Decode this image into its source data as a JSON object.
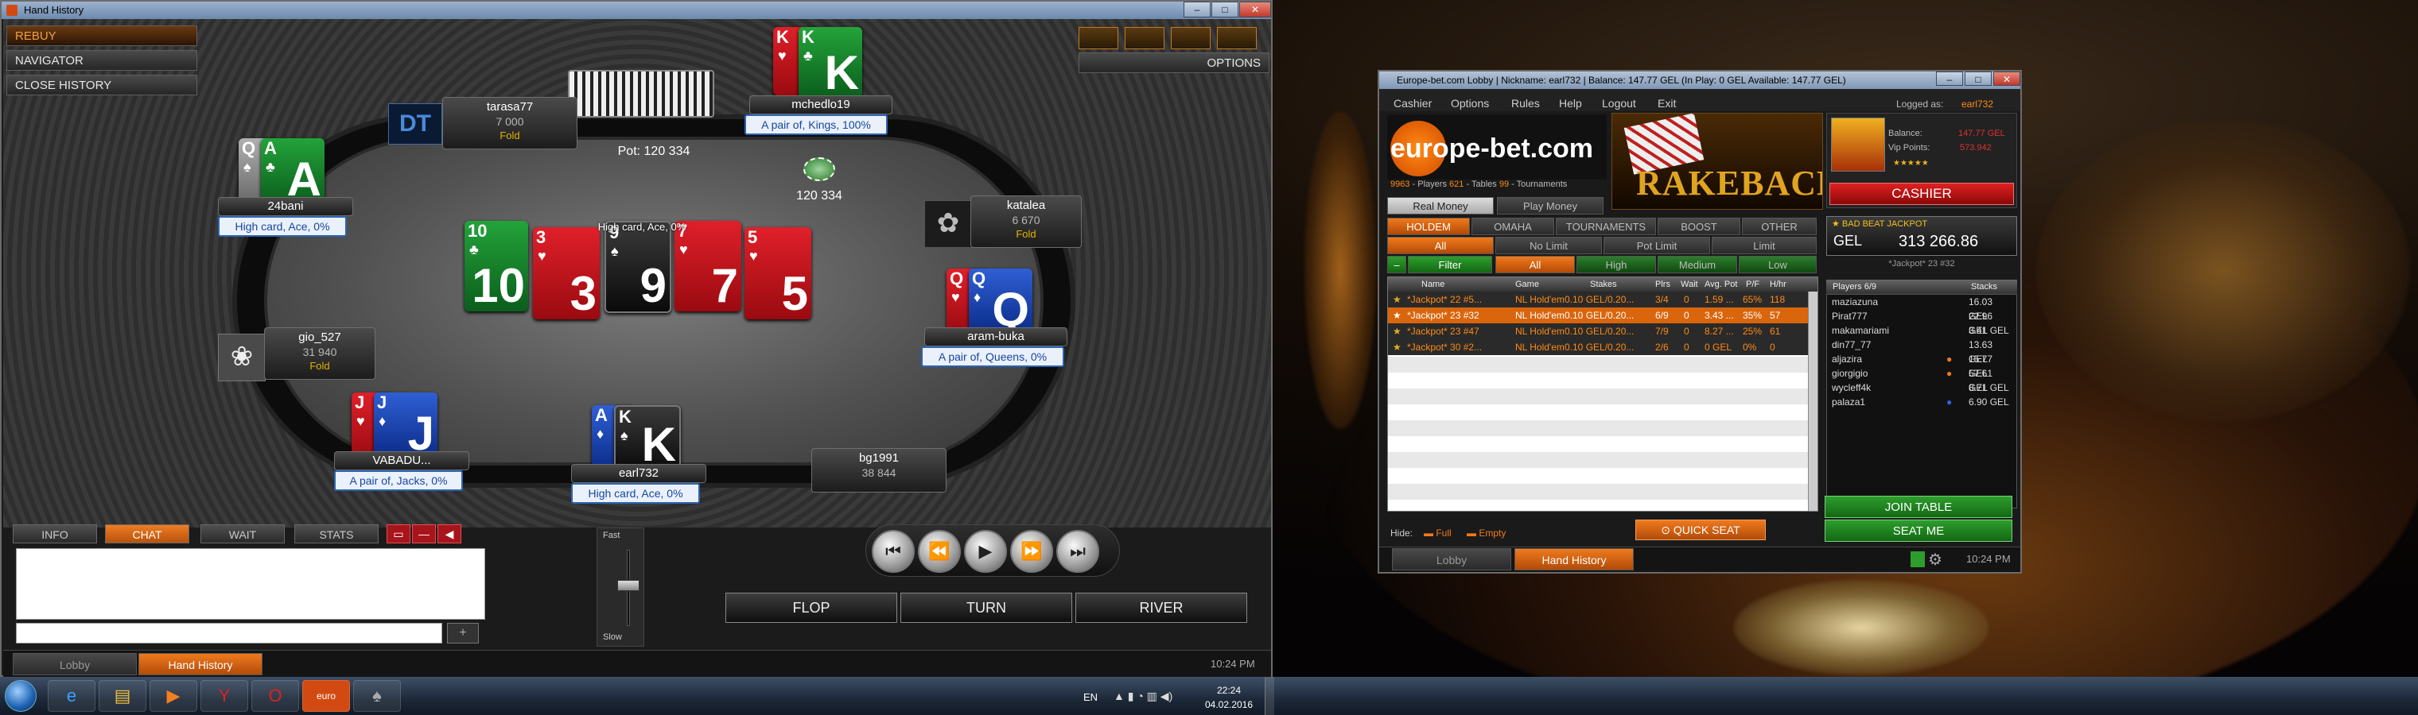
{
  "hand_history": {
    "title": "Hand History",
    "rebuy": "REBUY",
    "navigator": "NAVIGATOR",
    "close_history": "CLOSE HISTORY",
    "options": "OPTIONS",
    "pot": "Pot: 120 334",
    "pot_chips": "120 334",
    "board_caption": "High card, Ace, 0%",
    "board": [
      {
        "rank": "10",
        "suit": "♣",
        "color": "green"
      },
      {
        "rank": "3",
        "suit": "♥",
        "color": "red"
      },
      {
        "rank": "9",
        "suit": "♠",
        "color": "black"
      },
      {
        "rank": "7",
        "suit": "♥",
        "color": "red"
      },
      {
        "rank": "5",
        "suit": "♥",
        "color": "red"
      }
    ],
    "seats": {
      "tarasa77": {
        "name": "tarasa77",
        "chips": "7 000",
        "action": "Fold"
      },
      "mchedlo19": {
        "name": "mchedlo19",
        "hand": "A pair of, Kings, 100%",
        "cards": [
          {
            "rank": "K",
            "suit": "♥",
            "color": "red"
          },
          {
            "rank": "K",
            "suit": "♣",
            "color": "green"
          }
        ]
      },
      "b24bani": {
        "name": "24bani",
        "hand": "High card, Ace, 0%",
        "cards": [
          {
            "rank": "Q",
            "suit": "♠",
            "color": "grey"
          },
          {
            "rank": "A",
            "suit": "♣",
            "color": "green"
          }
        ]
      },
      "katalea": {
        "name": "katalea",
        "chips": "6 670",
        "action": "Fold"
      },
      "gio_527": {
        "name": "gio_527",
        "chips": "31 940",
        "action": "Fold"
      },
      "aram_buka": {
        "name": "aram-buka",
        "hand": "A pair of, Queens, 0%",
        "cards": [
          {
            "rank": "Q",
            "suit": "♥",
            "color": "red"
          },
          {
            "rank": "Q",
            "suit": "♦",
            "color": "blue"
          }
        ]
      },
      "vabadu": {
        "name": "VABADU...",
        "hand": "A pair of, Jacks, 0%",
        "cards": [
          {
            "rank": "J",
            "suit": "♥",
            "color": "red"
          },
          {
            "rank": "J",
            "suit": "♦",
            "color": "blue"
          }
        ]
      },
      "earl732": {
        "name": "earl732",
        "hand": "High card, Ace, 0%",
        "cards": [
          {
            "rank": "A",
            "suit": "♦",
            "color": "blue"
          },
          {
            "rank": "K",
            "suit": "♠",
            "color": "black"
          }
        ]
      },
      "bg1991": {
        "name": "bg1991",
        "chips": "38 844"
      }
    },
    "tabs": [
      "INFO",
      "CHAT",
      "WAIT",
      "STATS"
    ],
    "speed_fast": "Fast",
    "speed_slow": "Slow",
    "streets": [
      "FLOP",
      "TURN",
      "RIVER"
    ],
    "bottom_tabs": [
      "Lobby",
      "Hand History"
    ],
    "clock": "10:24 PM"
  },
  "lobby": {
    "title": "Europe-bet.com Lobby | Nickname: earl732 | Balance: 147.77 GEL (In Play: 0 GEL Available: 147.77 GEL)",
    "menu": [
      "Cashier",
      "Options",
      "Rules",
      "Help",
      "Logout",
      "Exit"
    ],
    "logged_as": "Logged as:",
    "nickname": "earl732",
    "brand": "europe-bet.com",
    "stats": {
      "players": "9963",
      "players_label": "- Players",
      "tables": "621",
      "tables_label": "- Tables",
      "tournaments": "99",
      "tournaments_label": "- Tournaments"
    },
    "rakeback": "RAKEBACK",
    "balance_label": "Balance:",
    "balance": "147.77 GEL",
    "vip_label": "Vip Points:",
    "vip": "573.942",
    "cashier": "CASHIER",
    "money_tabs": [
      "Real Money",
      "Play Money"
    ],
    "game_tabs": [
      "HOLDEM",
      "OMAHA",
      "TOURNAMENTS",
      "BOOST",
      "OTHER"
    ],
    "limit_tabs": [
      "All",
      "No Limit",
      "Pot Limit",
      "Limit"
    ],
    "stake_tabs": [
      "Filter",
      "All",
      "High",
      "Medium",
      "Low"
    ],
    "columns": [
      "Name",
      "Game",
      "Stakes",
      "Plrs",
      "Wait",
      "Avg. Pot",
      "P/F",
      "H/hr"
    ],
    "rows": [
      [
        "*Jackpot* 22 #5...",
        "NL Hold'em",
        "0.10 GEL/0.20...",
        "3/4",
        "0",
        "1.59 ...",
        "65%",
        "118"
      ],
      [
        "*Jackpot* 23 #32",
        "NL Hold'em",
        "0.10 GEL/0.20...",
        "6/9",
        "0",
        "3.43 ...",
        "35%",
        "57"
      ],
      [
        "*Jackpot* 23 #47",
        "NL Hold'em",
        "0.10 GEL/0.20...",
        "7/9",
        "0",
        "8.27 ...",
        "25%",
        "61"
      ],
      [
        "*Jackpot* 30 #2...",
        "NL Hold'em",
        "0.10 GEL/0.20...",
        "2/6",
        "0",
        "0 GEL",
        "0%",
        "0"
      ]
    ],
    "jackpot_label": "BAD BEAT JACKPOT",
    "jackpot_currency": "GEL",
    "jackpot_value": "313 266.86",
    "selected_table": "*Jackpot* 23 #32",
    "players_header": [
      "Players 6/9",
      "Stacks"
    ],
    "players": [
      [
        "maziazuna",
        "16.03 GEL"
      ],
      [
        "Pirat777",
        "22.96 GEL"
      ],
      [
        "makamariami",
        "3.41 GEL"
      ],
      [
        "din77_77",
        "13.63 GEL"
      ],
      [
        "aljazira",
        "15.77 GEL"
      ],
      [
        "giorgigio",
        "57.61 GEL"
      ],
      [
        "wycleff4k",
        "8.71 GEL"
      ],
      [
        "palaza1",
        "6.90 GEL"
      ]
    ],
    "hide_label": "Hide:",
    "hide_full": "Full",
    "hide_empty": "Empty",
    "quick_seat": "QUICK SEAT",
    "join_table": "JOIN TABLE",
    "seat_me": "SEAT ME",
    "bottom_tabs": [
      "Lobby",
      "Hand History"
    ],
    "clock": "10:24 PM"
  },
  "taskbar": {
    "lang": "EN",
    "time": "22:24",
    "date": "04.02.2016"
  }
}
